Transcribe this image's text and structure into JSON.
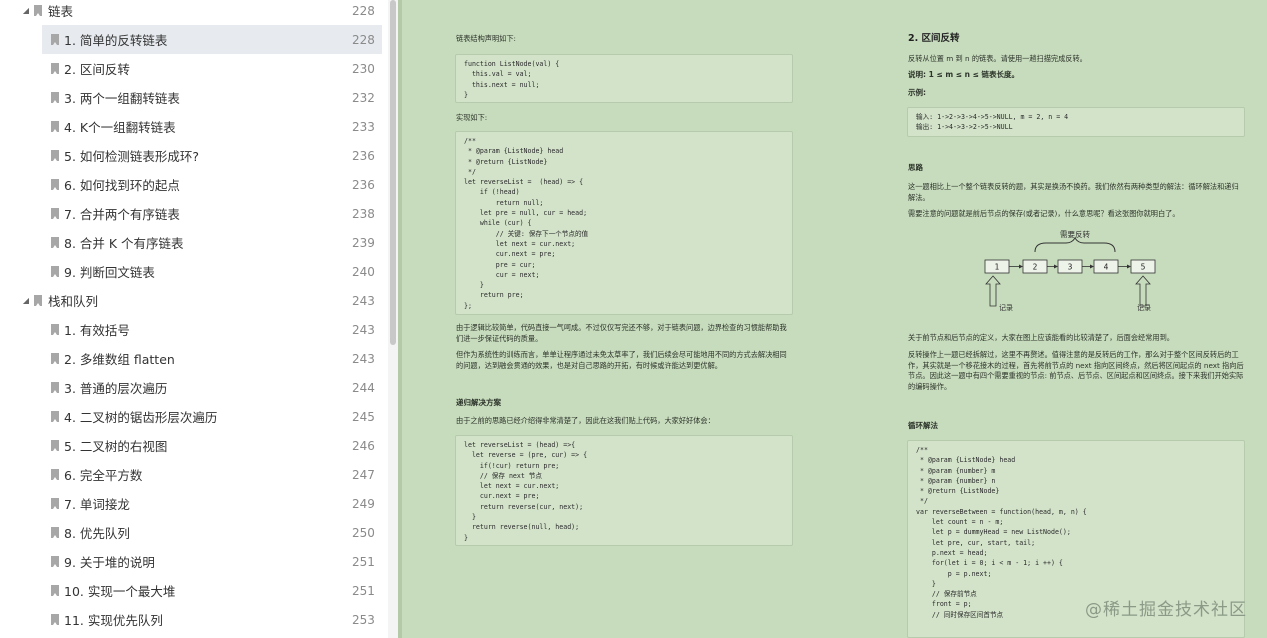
{
  "sidebar": {
    "items": [
      {
        "label": "链表",
        "page": "228",
        "level": 1,
        "expanded": true
      },
      {
        "label": "1. 简单的反转链表",
        "page": "228",
        "level": 2,
        "selected": true
      },
      {
        "label": "2. 区间反转",
        "page": "230",
        "level": 2
      },
      {
        "label": "3. 两个一组翻转链表",
        "page": "232",
        "level": 2
      },
      {
        "label": "4. K个一组翻转链表",
        "page": "233",
        "level": 2
      },
      {
        "label": "5. 如何检测链表形成环?",
        "page": "236",
        "level": 2
      },
      {
        "label": "6. 如何找到环的起点",
        "page": "236",
        "level": 2
      },
      {
        "label": "7. 合并两个有序链表",
        "page": "238",
        "level": 2
      },
      {
        "label": "8. 合并 K 个有序链表",
        "page": "239",
        "level": 2
      },
      {
        "label": "9. 判断回文链表",
        "page": "240",
        "level": 2
      },
      {
        "label": "栈和队列",
        "page": "243",
        "level": 1,
        "expanded": true
      },
      {
        "label": "1. 有效括号",
        "page": "243",
        "level": 2
      },
      {
        "label": "2. 多维数组 flatten",
        "page": "243",
        "level": 2
      },
      {
        "label": "3. 普通的层次遍历",
        "page": "244",
        "level": 2
      },
      {
        "label": "4. 二叉树的锯齿形层次遍历",
        "page": "245",
        "level": 2
      },
      {
        "label": "5. 二叉树的右视图",
        "page": "246",
        "level": 2
      },
      {
        "label": "6. 完全平方数",
        "page": "247",
        "level": 2
      },
      {
        "label": "7. 单词接龙",
        "page": "249",
        "level": 2
      },
      {
        "label": "8. 优先队列",
        "page": "250",
        "level": 2
      },
      {
        "label": "9. 关于堆的说明",
        "page": "251",
        "level": 2
      },
      {
        "label": "10. 实现一个最大堆",
        "page": "251",
        "level": 2
      },
      {
        "label": "11. 实现优先队列",
        "page": "253",
        "level": 2
      }
    ]
  },
  "left_page": {
    "intro": "链表结构声明如下:",
    "code1": "function ListNode(val) {\n  this.val = val;\n  this.next = null;\n}",
    "impl_label": "实现如下:",
    "code2": "/**\n * @param {ListNode} head\n * @return {ListNode}\n */\nlet reverseList =  (head) => {\n    if (!head)\n        return null;\n    let pre = null, cur = head;\n    while (cur) {\n        // 关键: 保存下一个节点的值\n        let next = cur.next;\n        cur.next = pre;\n        pre = cur;\n        cur = next;\n    }\n    return pre;\n};",
    "para1": "由于逻辑比较简单，代码直接一气呵成。不过仅仅写完还不够，对于链表问题，边界检查的习惯能帮助我们进一步保证代码的质量。",
    "para2": "但作为系统性的训练而言，单单让程序通过未免太草率了，我们后续会尽可能地用不同的方式去解决相同的问题，达到融会贯通的效果，也是对自己思路的开拓，有时候或许能达到更优解。",
    "recursive_title": "递归解决方案",
    "recursive_intro": "由于之前的思路已经介绍得非常清楚了，因此在这我们贴上代码，大家好好体会：",
    "code3": "let reverseList = (head) =>{\n  let reverse = (pre, cur) => {\n    if(!cur) return pre;\n    // 保存 next 节点\n    let next = cur.next;\n    cur.next = pre;\n    return reverse(cur, next);\n  }\n  return reverse(null, head);\n}"
  },
  "right_page": {
    "title": "2. 区间反转",
    "desc": "反转从位置 m 到 n 的链表。请使用一趟扫描完成反转。",
    "note": "说明: 1 ≤ m ≤ n ≤ 链表长度。",
    "example_label": "示例:",
    "example_code": "输入: 1->2->3->4->5->NULL, m = 2, n = 4\n输出: 1->4->3->2->5->NULL",
    "idea_title": "思路",
    "idea_para1": "这一题相比上一个整个链表反转的题，其实是换汤不换药。我们依然有两种类型的解法：循环解法和递归解法。",
    "idea_para2": "需要注意的问题就是前后节点的保存(或者记录)，什么意思呢？看这张图你就明白了。",
    "diagram": {
      "brace_label": "需要反转",
      "nodes": [
        "1",
        "2",
        "3",
        "4",
        "5"
      ],
      "left_note": "记录",
      "right_note": "记录"
    },
    "para3": "关于前节点和后节点的定义，大家在图上应该能看的比较清楚了，后面会经常用到。",
    "para4": "反转操作上一题已经拆解过，这里不再赘述。值得注意的是反转后的工作，那么对于整个区间反转后的工作，其实就是一个移花接木的过程，首先将前节点的 next 指向区间终点，然后将区间起点的 next 指向后节点。因此这一题中有四个需要重视的节点: 前节点、后节点、区间起点和区间终点。接下来我们开始实际的编码操作。",
    "loop_title": "循环解法",
    "code4": "/**\n * @param {ListNode} head\n * @param {number} m\n * @param {number} n\n * @return {ListNode}\n */\nvar reverseBetween = function(head, m, n) {\n    let count = n - m;\n    let p = dummyHead = new ListNode();\n    let pre, cur, start, tail;\n    p.next = head;\n    for(let i = 0; i < m - 1; i ++) {\n        p = p.next;\n    }\n    // 保存前节点\n    front = p;\n    // 同时保存区间首节点"
  },
  "watermark": "@稀土掘金技术社区",
  "colors": {
    "page_bg": "#c7dcbd",
    "code_bg": "#d3e3ca",
    "selected_row": "#e7ebef"
  }
}
